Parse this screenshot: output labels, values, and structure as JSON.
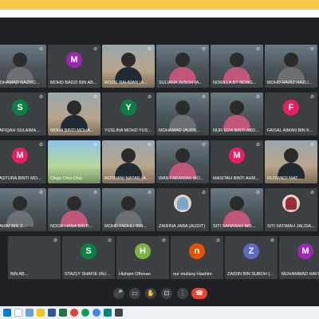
{
  "participants": [
    {
      "name": "MOHAMAD NAZRO...",
      "type": "video",
      "style": "grey"
    },
    {
      "name": "MOHD BADZI BIN AB...",
      "type": "avatar",
      "initial": "M",
      "color": "#9c27b0"
    },
    {
      "name": "ROZIE RAHMAN (A...",
      "type": "video",
      "style": "room"
    },
    {
      "name": "SULIANA JUSOH (A...",
      "type": "video",
      "style": "pink"
    },
    {
      "name": "NORILLA BT NONG...",
      "type": "video",
      "style": "pink"
    },
    {
      "name": "MOHD HAIRZ HAZLI...",
      "type": "video",
      "style": "grey"
    },
    {
      "name": "RAFIQAH SULAIMA...",
      "type": "avatar",
      "initial": "S",
      "color": "#0b8043"
    },
    {
      "name": "MOHA BINTI MOHA...",
      "type": "video",
      "style": "room"
    },
    {
      "name": "YUSLINA MOHD YUS...",
      "type": "avatar",
      "initial": "Y",
      "color": "#0b8043"
    },
    {
      "name": "MOHAMAD (AUDI)...",
      "type": "video",
      "style": "grey"
    },
    {
      "name": "NUR IZZA BINTI ABD...",
      "type": "video",
      "style": "pink"
    },
    {
      "name": "FAISAL AIMAN BIN K...",
      "type": "avatar",
      "initial": "F",
      "color": "#e91e63"
    },
    {
      "name": "NASTURA BINTI MO...",
      "type": "avatar",
      "initial": "M",
      "color": "#e91e63"
    },
    {
      "name": "Cikgu Choi Chai",
      "type": "shared"
    },
    {
      "name": "ROSNANI NAYAN (A...",
      "type": "video",
      "style": "room"
    },
    {
      "name": "WAN FAKARIAH MO...",
      "type": "video",
      "style": "pink"
    },
    {
      "name": "MASITAH BINTI AHM...",
      "type": "avatar",
      "initial": "M",
      "color": "#e91e63"
    },
    {
      "name": "RUSWADI MAT...",
      "type": "video",
      "style": "room"
    },
    {
      "name": "RAHIM BIN Z...",
      "type": "video",
      "style": "grey"
    },
    {
      "name": "NOOR HANA BINTI...",
      "type": "video",
      "style": "pink"
    },
    {
      "name": "MOHD FADHLI BIN...",
      "type": "video",
      "style": "grey"
    },
    {
      "name": "ZAIRINA JABA (AUDIT)",
      "type": "image-avatar",
      "tone": "blue"
    },
    {
      "name": "SITI SANARAH MO...",
      "type": "video",
      "style": "pink"
    },
    {
      "name": "SITI FATIMAH JALIDA...",
      "type": "image-avatar",
      "tone": "red"
    },
    {
      "name": "BIN AB...",
      "type": "avatar",
      "initial": "",
      "color": "#3c4043"
    },
    {
      "name": "STAZLY SHAFIE (AUDI...",
      "type": "avatar",
      "initial": "S",
      "color": "#0b8043"
    },
    {
      "name": "Hisham Othman",
      "type": "avatar",
      "initial": "H",
      "color": "#7cb342"
    },
    {
      "name": "nur mullany Hashim",
      "type": "avatar",
      "initial": "n",
      "color": "#e65100"
    },
    {
      "name": "ZAIDIN BIN SUBOH (...",
      "type": "avatar",
      "initial": "Z",
      "color": "#5c6bc0"
    },
    {
      "name": "MUHAMMAD HAFIDZ...",
      "type": "avatar",
      "initial": "M",
      "color": "#9c27b0"
    }
  ],
  "controls": {
    "mic": "🎤",
    "camera": "▭",
    "hand": "✋",
    "present": "⊡",
    "more": "⋮",
    "end": "☎"
  },
  "colors": {
    "end_call": "#ea4335",
    "background": "#202124",
    "tile": "#3c4043"
  }
}
